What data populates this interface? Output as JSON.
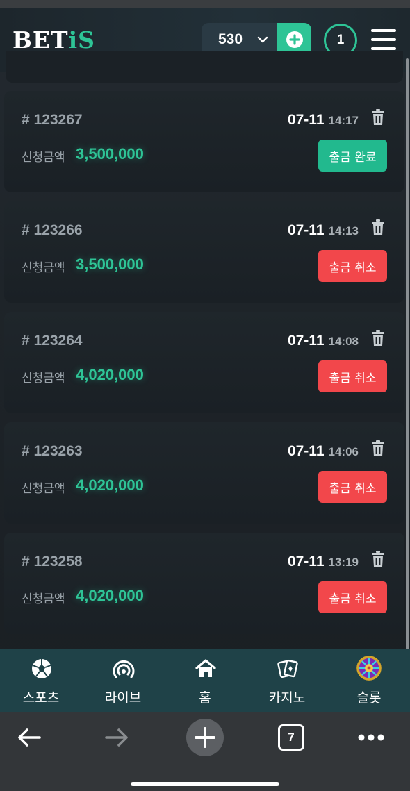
{
  "header": {
    "logo_text": "BET",
    "logo_accent": "iS",
    "balance": "530",
    "notification_count": "1"
  },
  "withdrawals": [
    {
      "id": "# 123267",
      "date": "07-11",
      "time": "14:17",
      "label": "신청금액",
      "amount": "3,500,000",
      "status": "출금 완료",
      "status_type": "done"
    },
    {
      "id": "# 123266",
      "date": "07-11",
      "time": "14:13",
      "label": "신청금액",
      "amount": "3,500,000",
      "status": "출금 취소",
      "status_type": "cancel"
    },
    {
      "id": "# 123264",
      "date": "07-11",
      "time": "14:08",
      "label": "신청금액",
      "amount": "4,020,000",
      "status": "출금 취소",
      "status_type": "cancel"
    },
    {
      "id": "# 123263",
      "date": "07-11",
      "time": "14:06",
      "label": "신청금액",
      "amount": "4,020,000",
      "status": "출금 취소",
      "status_type": "cancel"
    },
    {
      "id": "# 123258",
      "date": "07-11",
      "time": "13:19",
      "label": "신청금액",
      "amount": "4,020,000",
      "status": "출금 취소",
      "status_type": "cancel"
    }
  ],
  "bottom_nav": [
    {
      "label": "스포츠",
      "icon": "soccer-ball-icon"
    },
    {
      "label": "라이브",
      "icon": "live-broadcast-icon"
    },
    {
      "label": "홈",
      "icon": "home-icon"
    },
    {
      "label": "카지노",
      "icon": "cards-icon"
    },
    {
      "label": "슬롯",
      "icon": "slot-wheel-icon"
    }
  ],
  "browser": {
    "tab_count": "7"
  },
  "colors": {
    "accent": "#2ec496",
    "cancel": "#f2474b",
    "done": "#22b98e",
    "nav_bg": "#1f4248"
  }
}
